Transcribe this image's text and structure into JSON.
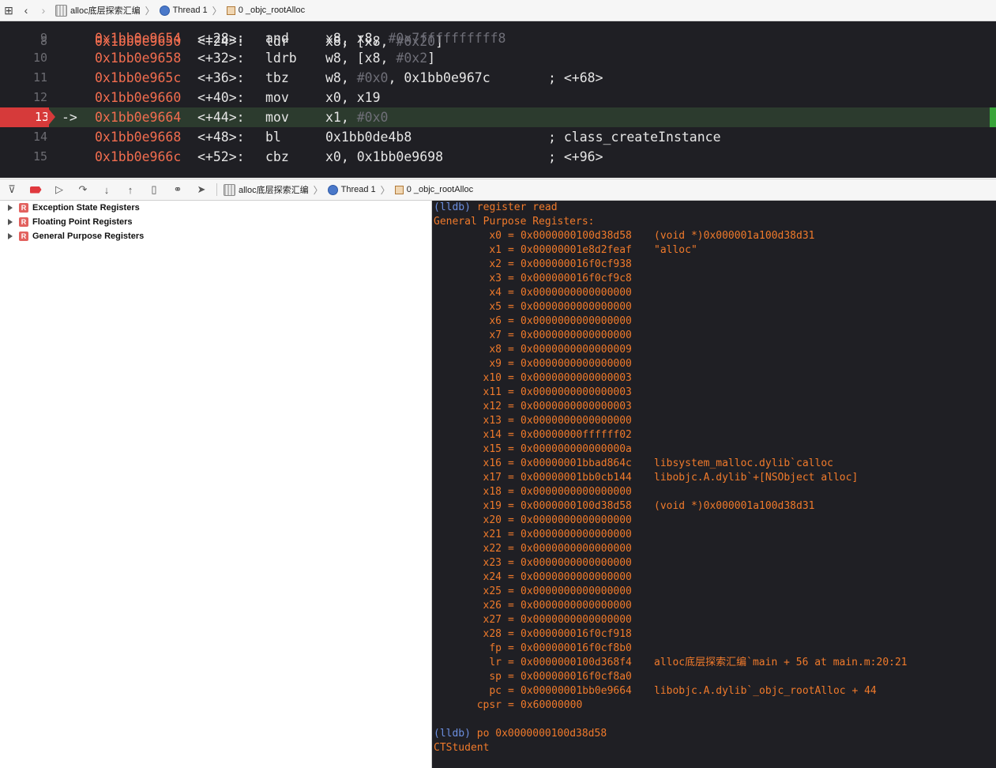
{
  "top_bar": {
    "project": "alloc底层探索汇编",
    "thread": "Thread 1",
    "frame": "0 _objc_rootAlloc"
  },
  "disassembly": [
    {
      "line": "9",
      "addr": "0x1bb0e9654",
      "offset": "<+28>:",
      "op": "and",
      "args": "x8, x8, ",
      "args_dim": "#0x7ffffffffff8",
      "comment": ""
    },
    {
      "line": "10",
      "addr": "0x1bb0e9658",
      "offset": "<+32>:",
      "op": "ldrb",
      "args": "w8, [x8, ",
      "args_dim": "#0x2",
      "args_tail": "]",
      "comment": ""
    },
    {
      "line": "11",
      "addr": "0x1bb0e965c",
      "offset": "<+36>:",
      "op": "tbz",
      "args": "w8, ",
      "args_dim": "#0x0",
      "args_tail": ", 0x1bb0e967c",
      "comment": "; <+68>"
    },
    {
      "line": "12",
      "addr": "0x1bb0e9660",
      "offset": "<+40>:",
      "op": "mov",
      "args": "x0, x19",
      "comment": ""
    },
    {
      "line": "13",
      "addr": "0x1bb0e9664",
      "offset": "<+44>:",
      "op": "mov",
      "args": "x1, ",
      "args_dim": "#0x0",
      "comment": "",
      "current": true,
      "arrow": "->"
    },
    {
      "line": "14",
      "addr": "0x1bb0e9668",
      "offset": "<+48>:",
      "op": "bl",
      "args": "0x1bb0de4b8",
      "comment": "; class_createInstance"
    },
    {
      "line": "15",
      "addr": "0x1bb0e966c",
      "offset": "<+52>:",
      "op": "cbz",
      "args": "x0, 0x1bb0e9698",
      "comment": "; <+96>"
    }
  ],
  "debug_bar": {
    "project": "alloc底层探索汇编",
    "thread": "Thread 1",
    "frame": "0 _objc_rootAlloc"
  },
  "variables": [
    {
      "badge": "R",
      "label": "Exception State Registers"
    },
    {
      "badge": "R",
      "label": "Floating Point Registers"
    },
    {
      "badge": "R",
      "label": "General Purpose Registers"
    }
  ],
  "console": {
    "prompt": "(lldb)",
    "cmd1": "register read",
    "header": "General Purpose Registers:",
    "registers": [
      {
        "name": "x0",
        "value": "0x0000000100d38d58",
        "desc": "(void *)0x000001a100d38d31"
      },
      {
        "name": "x1",
        "value": "0x00000001e8d2feaf",
        "desc": "\"alloc\""
      },
      {
        "name": "x2",
        "value": "0x000000016f0cf938",
        "desc": ""
      },
      {
        "name": "x3",
        "value": "0x000000016f0cf9c8",
        "desc": ""
      },
      {
        "name": "x4",
        "value": "0x0000000000000000",
        "desc": ""
      },
      {
        "name": "x5",
        "value": "0x0000000000000000",
        "desc": ""
      },
      {
        "name": "x6",
        "value": "0x0000000000000000",
        "desc": ""
      },
      {
        "name": "x7",
        "value": "0x0000000000000000",
        "desc": ""
      },
      {
        "name": "x8",
        "value": "0x0000000000000009",
        "desc": ""
      },
      {
        "name": "x9",
        "value": "0x0000000000000000",
        "desc": ""
      },
      {
        "name": "x10",
        "value": "0x0000000000000003",
        "desc": ""
      },
      {
        "name": "x11",
        "value": "0x0000000000000003",
        "desc": ""
      },
      {
        "name": "x12",
        "value": "0x0000000000000003",
        "desc": ""
      },
      {
        "name": "x13",
        "value": "0x0000000000000000",
        "desc": ""
      },
      {
        "name": "x14",
        "value": "0x00000000ffffff02",
        "desc": ""
      },
      {
        "name": "x15",
        "value": "0x000000000000000a",
        "desc": ""
      },
      {
        "name": "x16",
        "value": "0x00000001bbad864c",
        "desc": "libsystem_malloc.dylib`calloc"
      },
      {
        "name": "x17",
        "value": "0x00000001bb0cb144",
        "desc": "libobjc.A.dylib`+[NSObject alloc]"
      },
      {
        "name": "x18",
        "value": "0x0000000000000000",
        "desc": ""
      },
      {
        "name": "x19",
        "value": "0x0000000100d38d58",
        "desc": "(void *)0x000001a100d38d31"
      },
      {
        "name": "x20",
        "value": "0x0000000000000000",
        "desc": ""
      },
      {
        "name": "x21",
        "value": "0x0000000000000000",
        "desc": ""
      },
      {
        "name": "x22",
        "value": "0x0000000000000000",
        "desc": ""
      },
      {
        "name": "x23",
        "value": "0x0000000000000000",
        "desc": ""
      },
      {
        "name": "x24",
        "value": "0x0000000000000000",
        "desc": ""
      },
      {
        "name": "x25",
        "value": "0x0000000000000000",
        "desc": ""
      },
      {
        "name": "x26",
        "value": "0x0000000000000000",
        "desc": ""
      },
      {
        "name": "x27",
        "value": "0x0000000000000000",
        "desc": ""
      },
      {
        "name": "x28",
        "value": "0x000000016f0cf918",
        "desc": ""
      },
      {
        "name": "fp",
        "value": "0x000000016f0cf8b0",
        "desc": ""
      },
      {
        "name": "lr",
        "value": "0x0000000100d368f4",
        "desc": "alloc底层探索汇编`main + 56 at main.m:20:21"
      },
      {
        "name": "sp",
        "value": "0x000000016f0cf8a0",
        "desc": ""
      },
      {
        "name": "pc",
        "value": "0x00000001bb0e9664",
        "desc": "libobjc.A.dylib`_objc_rootAlloc + 44"
      },
      {
        "name": "cpsr",
        "value": "0x60000000",
        "desc": ""
      }
    ],
    "cmd2": "po 0x0000000100d38d58",
    "output": "CTStudent"
  }
}
